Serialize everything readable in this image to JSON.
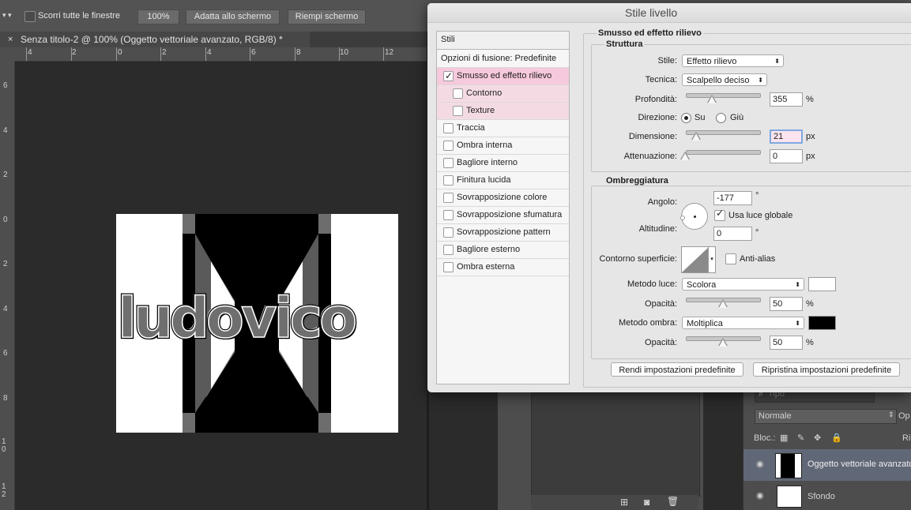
{
  "options_bar": {
    "scroll_all_label": "Scorri tutte le finestre",
    "zoom_100_label": "100%",
    "fit_screen_label": "Adatta allo schermo",
    "fill_screen_label": "Riempi schermo"
  },
  "document": {
    "tab_title": "Senza titolo-2 @ 100% (Oggetto vettoriale avanzato, RGB/8) *",
    "canvas_text": "ludovico"
  },
  "rulers": {
    "h_ticks": [
      "4",
      "2",
      "0",
      "2",
      "4",
      "6",
      "8",
      "10",
      "12"
    ],
    "v_ticks": [
      "6",
      "4",
      "2",
      "0",
      "2",
      "4",
      "6",
      "8",
      "10",
      "12"
    ]
  },
  "layers_panel": {
    "filter_placeholder": "Tipo",
    "blend_mode": "Normale",
    "opacity_label": "Op",
    "lock_label": "Bloc.:",
    "fill_label": "Ri",
    "layers": [
      {
        "name": "Oggetto vettoriale avanzato"
      },
      {
        "name": "Sfondo"
      }
    ]
  },
  "dialog": {
    "title": "Stile livello",
    "styles_header": "Stili",
    "blend_options": "Opzioni di fusione: Predefinite",
    "style_items": [
      {
        "label": "Smusso ed effetto rilievo",
        "checked": true
      },
      {
        "label": "Contorno",
        "checked": false
      },
      {
        "label": "Texture",
        "checked": false
      },
      {
        "label": "Traccia",
        "checked": false
      },
      {
        "label": "Ombra interna",
        "checked": false
      },
      {
        "label": "Bagliore interno",
        "checked": false
      },
      {
        "label": "Finitura lucida",
        "checked": false
      },
      {
        "label": "Sovrapposizione colore",
        "checked": false
      },
      {
        "label": "Sovrapposizione sfumatura",
        "checked": false
      },
      {
        "label": "Sovrapposizione pattern",
        "checked": false
      },
      {
        "label": "Bagliore esterno",
        "checked": false
      },
      {
        "label": "Ombra esterna",
        "checked": false
      }
    ],
    "bevel_title": "Smusso ed effetto rilievo",
    "structure": {
      "title": "Struttura",
      "style_label": "Stile:",
      "style_value": "Effetto rilievo",
      "technique_label": "Tecnica:",
      "technique_value": "Scalpello deciso",
      "depth_label": "Profondità:",
      "depth_value": "355",
      "depth_unit": "%",
      "direction_label": "Direzione:",
      "dir_up": "Su",
      "dir_down": "Giù",
      "size_label": "Dimensione:",
      "size_value": "21",
      "size_unit": "px",
      "soften_label": "Attenuazione:",
      "soften_value": "0",
      "soften_unit": "px"
    },
    "shading": {
      "title": "Ombreggiatura",
      "angle_label": "Angolo:",
      "angle_value": "-177",
      "degree": "°",
      "global_light_label": "Usa luce globale",
      "altitude_label": "Altitudine:",
      "altitude_value": "0",
      "gloss_contour_label": "Contorno superficie:",
      "antialias_label": "Anti-alias",
      "highlight_mode_label": "Metodo luce:",
      "highlight_mode_value": "Scolora",
      "highlight_color": "#ffffff",
      "highlight_opacity_label": "Opacità:",
      "highlight_opacity_value": "50",
      "shadow_mode_label": "Metodo ombra:",
      "shadow_mode_value": "Moltiplica",
      "shadow_color": "#000000",
      "shadow_opacity_label": "Opacità:",
      "shadow_opacity_value": "50",
      "pct": "%"
    },
    "make_default_label": "Rendi impostazioni predefinite",
    "reset_default_label": "Ripristina impostazioni predefinite"
  }
}
